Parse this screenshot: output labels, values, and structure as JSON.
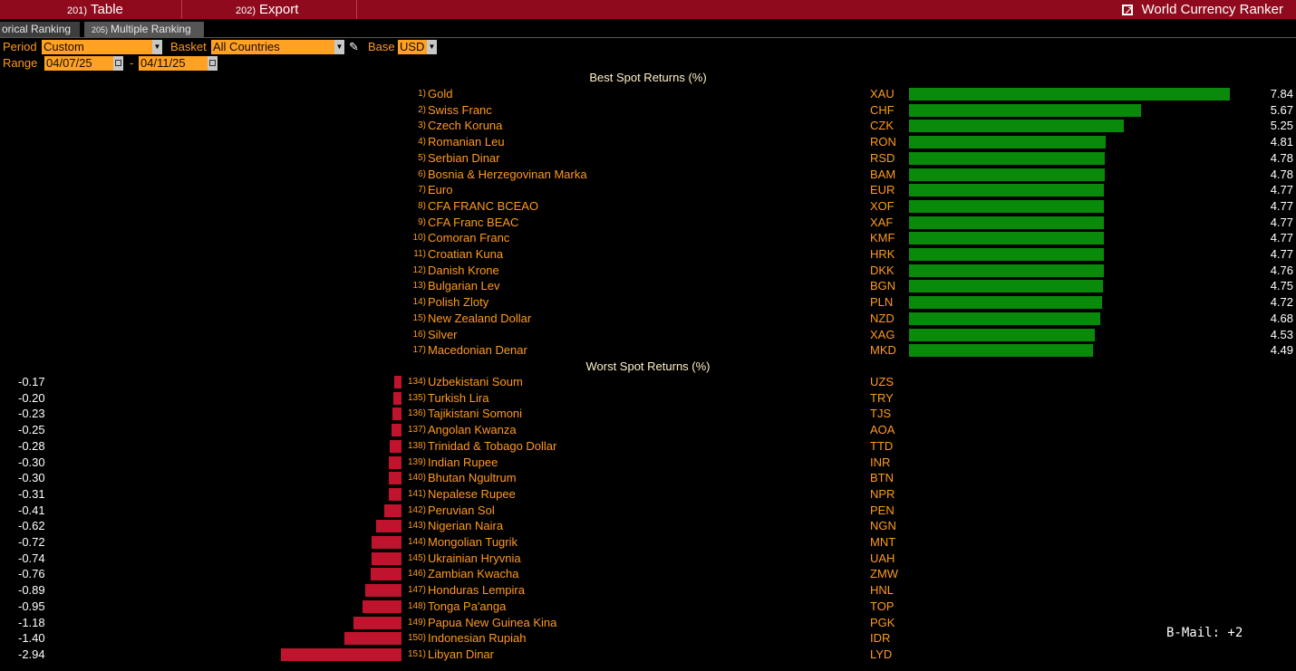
{
  "toolbar": {
    "table_num": "201)",
    "table_label": "Table",
    "export_num": "202)",
    "export_label": "Export",
    "app_title": "World Currency Ranker"
  },
  "tabs": [
    {
      "num": "",
      "label": "orical Ranking"
    },
    {
      "num": "205)",
      "label": "Multiple Ranking"
    }
  ],
  "controls": {
    "period_label": "Period",
    "period_value": "Custom",
    "basket_label": "Basket",
    "basket_value": "All Countries",
    "base_label": "Base",
    "base_value": "USD",
    "range_label": "Range",
    "range_start": "04/07/25",
    "range_sep": "-",
    "range_end": "04/11/25"
  },
  "best": {
    "title": "Best Spot Returns (%)",
    "rows": [
      {
        "rank": "1)",
        "name": "Gold",
        "code": "XAU",
        "value": 7.84,
        "label": "7.84"
      },
      {
        "rank": "2)",
        "name": "Swiss Franc",
        "code": "CHF",
        "value": 5.67,
        "label": "5.67"
      },
      {
        "rank": "3)",
        "name": "Czech Koruna",
        "code": "CZK",
        "value": 5.25,
        "label": "5.25"
      },
      {
        "rank": "4)",
        "name": "Romanian Leu",
        "code": "RON",
        "value": 4.81,
        "label": "4.81"
      },
      {
        "rank": "5)",
        "name": "Serbian Dinar",
        "code": "RSD",
        "value": 4.78,
        "label": "4.78"
      },
      {
        "rank": "6)",
        "name": "Bosnia & Herzegovinan Marka",
        "code": "BAM",
        "value": 4.78,
        "label": "4.78"
      },
      {
        "rank": "7)",
        "name": "Euro",
        "code": "EUR",
        "value": 4.77,
        "label": "4.77"
      },
      {
        "rank": "8)",
        "name": "CFA FRANC BCEAO",
        "code": "XOF",
        "value": 4.77,
        "label": "4.77"
      },
      {
        "rank": "9)",
        "name": "CFA Franc BEAC",
        "code": "XAF",
        "value": 4.77,
        "label": "4.77"
      },
      {
        "rank": "10)",
        "name": "Comoran Franc",
        "code": "KMF",
        "value": 4.77,
        "label": "4.77"
      },
      {
        "rank": "11)",
        "name": "Croatian Kuna",
        "code": "HRK",
        "value": 4.77,
        "label": "4.77"
      },
      {
        "rank": "12)",
        "name": "Danish Krone",
        "code": "DKK",
        "value": 4.76,
        "label": "4.76"
      },
      {
        "rank": "13)",
        "name": "Bulgarian Lev",
        "code": "BGN",
        "value": 4.75,
        "label": "4.75"
      },
      {
        "rank": "14)",
        "name": "Polish Zloty",
        "code": "PLN",
        "value": 4.72,
        "label": "4.72"
      },
      {
        "rank": "15)",
        "name": "New Zealand Dollar",
        "code": "NZD",
        "value": 4.68,
        "label": "4.68"
      },
      {
        "rank": "16)",
        "name": "Silver",
        "code": "XAG",
        "value": 4.53,
        "label": "4.53"
      },
      {
        "rank": "17)",
        "name": "Macedonian Denar",
        "code": "MKD",
        "value": 4.49,
        "label": "4.49"
      }
    ]
  },
  "worst": {
    "title": "Worst Spot Returns (%)",
    "rows": [
      {
        "rank": "134)",
        "name": "Uzbekistani Soum",
        "code": "UZS",
        "value": -0.17,
        "label": "-0.17"
      },
      {
        "rank": "135)",
        "name": "Turkish Lira",
        "code": "TRY",
        "value": -0.2,
        "label": "-0.20"
      },
      {
        "rank": "136)",
        "name": "Tajikistani Somoni",
        "code": "TJS",
        "value": -0.23,
        "label": "-0.23"
      },
      {
        "rank": "137)",
        "name": "Angolan Kwanza",
        "code": "AOA",
        "value": -0.25,
        "label": "-0.25"
      },
      {
        "rank": "138)",
        "name": "Trinidad & Tobago Dollar",
        "code": "TTD",
        "value": -0.28,
        "label": "-0.28"
      },
      {
        "rank": "139)",
        "name": "Indian Rupee",
        "code": "INR",
        "value": -0.3,
        "label": "-0.30"
      },
      {
        "rank": "140)",
        "name": "Bhutan Ngultrum",
        "code": "BTN",
        "value": -0.3,
        "label": "-0.30"
      },
      {
        "rank": "141)",
        "name": "Nepalese Rupee",
        "code": "NPR",
        "value": -0.31,
        "label": "-0.31"
      },
      {
        "rank": "142)",
        "name": "Peruvian Sol",
        "code": "PEN",
        "value": -0.41,
        "label": "-0.41"
      },
      {
        "rank": "143)",
        "name": "Nigerian Naira",
        "code": "NGN",
        "value": -0.62,
        "label": "-0.62"
      },
      {
        "rank": "144)",
        "name": "Mongolian Tugrik",
        "code": "MNT",
        "value": -0.72,
        "label": "-0.72"
      },
      {
        "rank": "145)",
        "name": "Ukrainian Hryvnia",
        "code": "UAH",
        "value": -0.74,
        "label": "-0.74"
      },
      {
        "rank": "146)",
        "name": "Zambian Kwacha",
        "code": "ZMW",
        "value": -0.76,
        "label": "-0.76"
      },
      {
        "rank": "147)",
        "name": "Honduras Lempira",
        "code": "HNL",
        "value": -0.89,
        "label": "-0.89"
      },
      {
        "rank": "148)",
        "name": "Tonga Pa'anga",
        "code": "TOP",
        "value": -0.95,
        "label": "-0.95"
      },
      {
        "rank": "149)",
        "name": "Papua New Guinea Kina",
        "code": "PGK",
        "value": -1.18,
        "label": "-1.18"
      },
      {
        "rank": "150)",
        "name": "Indonesian Rupiah",
        "code": "IDR",
        "value": -1.4,
        "label": "-1.40"
      },
      {
        "rank": "151)",
        "name": "Libyan Dinar",
        "code": "LYD",
        "value": -2.94,
        "label": "-2.94"
      }
    ]
  },
  "colors": {
    "positive_bar": "#0a8a0a",
    "negative_bar": "#c0142e",
    "toolbar_bg": "#8e0a1c",
    "text_orange": "#ff9a1e"
  },
  "status": {
    "bmail": "B-Mail: +2"
  }
}
